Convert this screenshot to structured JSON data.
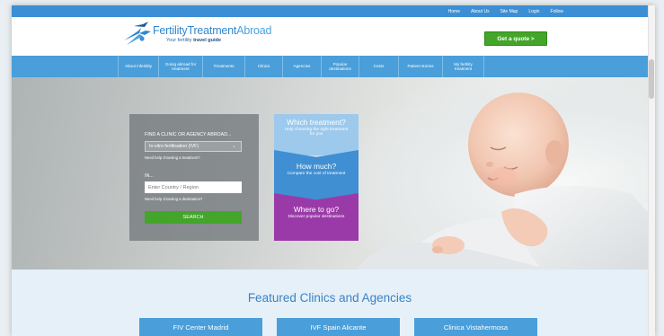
{
  "topbar": {
    "links": [
      "Home",
      "About Us",
      "Site Map",
      "Login",
      "Follow"
    ]
  },
  "brand": {
    "name_part1": "Fertility",
    "name_part2": "Treatment",
    "name_part3": "Abroad",
    "tagline_prefix": "Your fertility ",
    "tagline_bold": "travel guide"
  },
  "header": {
    "quote_button": "Get a quote >"
  },
  "nav": {
    "items": [
      "About infertility",
      "Going abroad for treatment",
      "Treatments",
      "Clinics",
      "Agencies",
      "Popular destinations",
      "Costs",
      "Patient stories",
      "My fertility treatment"
    ]
  },
  "search": {
    "heading": "FIND A CLINIC OR AGENCY ABROAD...",
    "treatment_value": "In-vitro fertilisation (IVF)",
    "treatment_help": "Need help choosing a treatment?",
    "in_label": "IN...",
    "destination_placeholder": "Enter Country / Region",
    "destination_help": "Need help choosing a destination?",
    "search_button": "SEARCH"
  },
  "tiles": [
    {
      "title": "Which treatment?",
      "subtitle": "Help choosing the right treatment for you"
    },
    {
      "title": "How much?",
      "subtitle": "Compare the cost of treatment"
    },
    {
      "title": "Where to go?",
      "subtitle": "Discover popular destinations"
    }
  ],
  "featured": {
    "title": "Featured Clinics and Agencies",
    "clinics": [
      "FIV Center Madrid",
      "IVF Spain Alicante",
      "Clinica Vistahermosa"
    ]
  },
  "colors": {
    "primary_blue": "#4a9ed9",
    "topbar_blue": "#3c8fd4",
    "accent_green": "#43a52a",
    "purple": "#9a3aa8",
    "light_blue": "#9cc9ec"
  }
}
